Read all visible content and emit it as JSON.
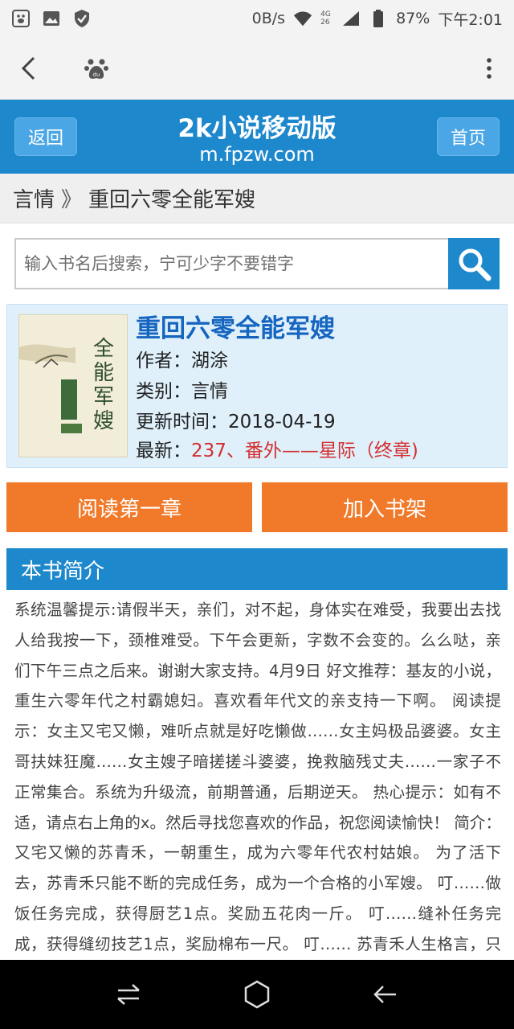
{
  "status_bar": {
    "net_speed": "0B/s",
    "network_badge": "4G 26",
    "battery": "87%",
    "time": "下午2:01"
  },
  "header": {
    "back_label": "返回",
    "home_label": "首页",
    "title": "2k小说移动版",
    "subtitle": "m.fpzw.com"
  },
  "breadcrumb": {
    "category": "言情",
    "separator": "》",
    "book": "重回六零全能军嫂"
  },
  "search": {
    "placeholder": "输入书名后搜索，宁可少字不要错字"
  },
  "book": {
    "title": "重回六零全能军嫂",
    "author_label": "作者：",
    "author": "湖涂",
    "category_label": "类别：",
    "category": "言情",
    "updated_label": "更新时间：",
    "updated": "2018-04-19",
    "latest_label": "最新：",
    "latest": "237、番外——星际（终章)",
    "cover_text": "全能军嫂"
  },
  "actions": {
    "read_first": "阅读第一章",
    "add_shelf": "加入书架"
  },
  "intro": {
    "heading": "本书简介",
    "text": "系统温馨提示:请假半天，亲们，对不起，身体实在难受，我要出去找人给我按一下，颈椎难受。下午会更新，字数不会变的。么么哒，亲们下午三点之后来。谢谢大家支持。4月9日 好文推荐：基友的小说，重生六零年代之村霸媳妇。喜欢看年代文的亲支持一下啊。 阅读提示：女主又宅又懒，难听点就是好吃懒做……女主妈极品婆婆。女主哥扶妹狂魔……女主嫂子暗搓搓斗婆婆，挽救脑残丈夫……一家子不正常集合。系统为升级流，前期普通，后期逆天。 热心提示：如有不适，请点右上角的x。然后寻找您喜欢的作品，祝您阅读愉快！ 简介： 又宅又懒的苏青禾，一朝重生，成为六零年代农村姑娘。 为了活下去，苏青禾只能不断的完成任务，成为一个合格的小军嫂。 叮……做饭任务完成，获得厨艺1点。奖励五花肉一斤。 叮……缝补任务完成，获得缝纫技艺1点，奖励棉布一尺。 叮…… 苏青禾人生格言，只有想不到，没有做不到！ 入V通知：感谢各位小天使的支持，本文于"
  },
  "colors": {
    "header_blue": "#1e88cd",
    "button_orange": "#f07a2a",
    "card_bg": "#dff0fb",
    "link_blue": "#1565c0",
    "latest_red": "#d32f2f"
  }
}
